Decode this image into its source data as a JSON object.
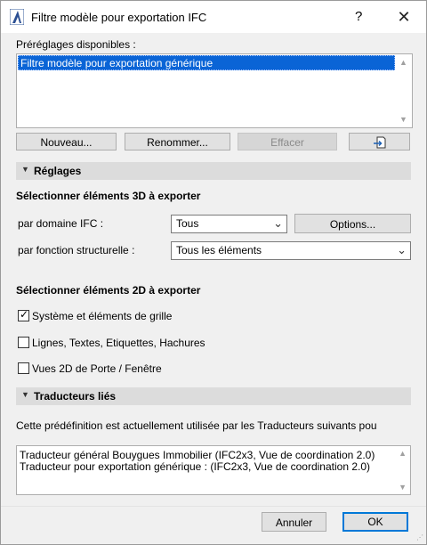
{
  "window": {
    "title": "Filtre modèle pour exportation IFC",
    "help": "?",
    "close": "✕"
  },
  "presets": {
    "label": "Préréglages disponibles :",
    "items": [
      "Filtre modèle pour exportation générique"
    ]
  },
  "buttons": {
    "new": "Nouveau...",
    "rename": "Renommer...",
    "delete": "Effacer",
    "import_icon": "import-icon"
  },
  "settings": {
    "header": "Réglages",
    "select3d_title": "Sélectionner éléments 3D à exporter",
    "ifc_domain_label": "par domaine IFC :",
    "ifc_domain_value": "Tous",
    "options_button": "Options...",
    "structural_label": "par fonction structurelle :",
    "structural_value": "Tous les éléments",
    "select2d_title": "Sélectionner éléments 2D à exporter",
    "checkboxes": [
      {
        "label": "Système et éléments de grille",
        "checked": true
      },
      {
        "label": "Lignes, Textes, Etiquettes, Hachures",
        "checked": false
      },
      {
        "label": "Vues 2D de Porte / Fenêtre",
        "checked": false
      }
    ]
  },
  "translators": {
    "header": "Traducteurs liés",
    "description": "Cette prédéfinition est actuellement utilisée par les Traducteurs suivants pou",
    "lines": [
      "Traducteur général Bouygues Immobilier (IFC2x3, Vue de coordination 2.0)",
      "Traducteur pour exportation générique : (IFC2x3, Vue de coordination 2.0)"
    ]
  },
  "footer": {
    "cancel": "Annuler",
    "ok": "OK"
  },
  "colors": {
    "selection": "#0a64d6",
    "default_button_border": "#0078d7",
    "section_bg": "#dcdcdc"
  }
}
